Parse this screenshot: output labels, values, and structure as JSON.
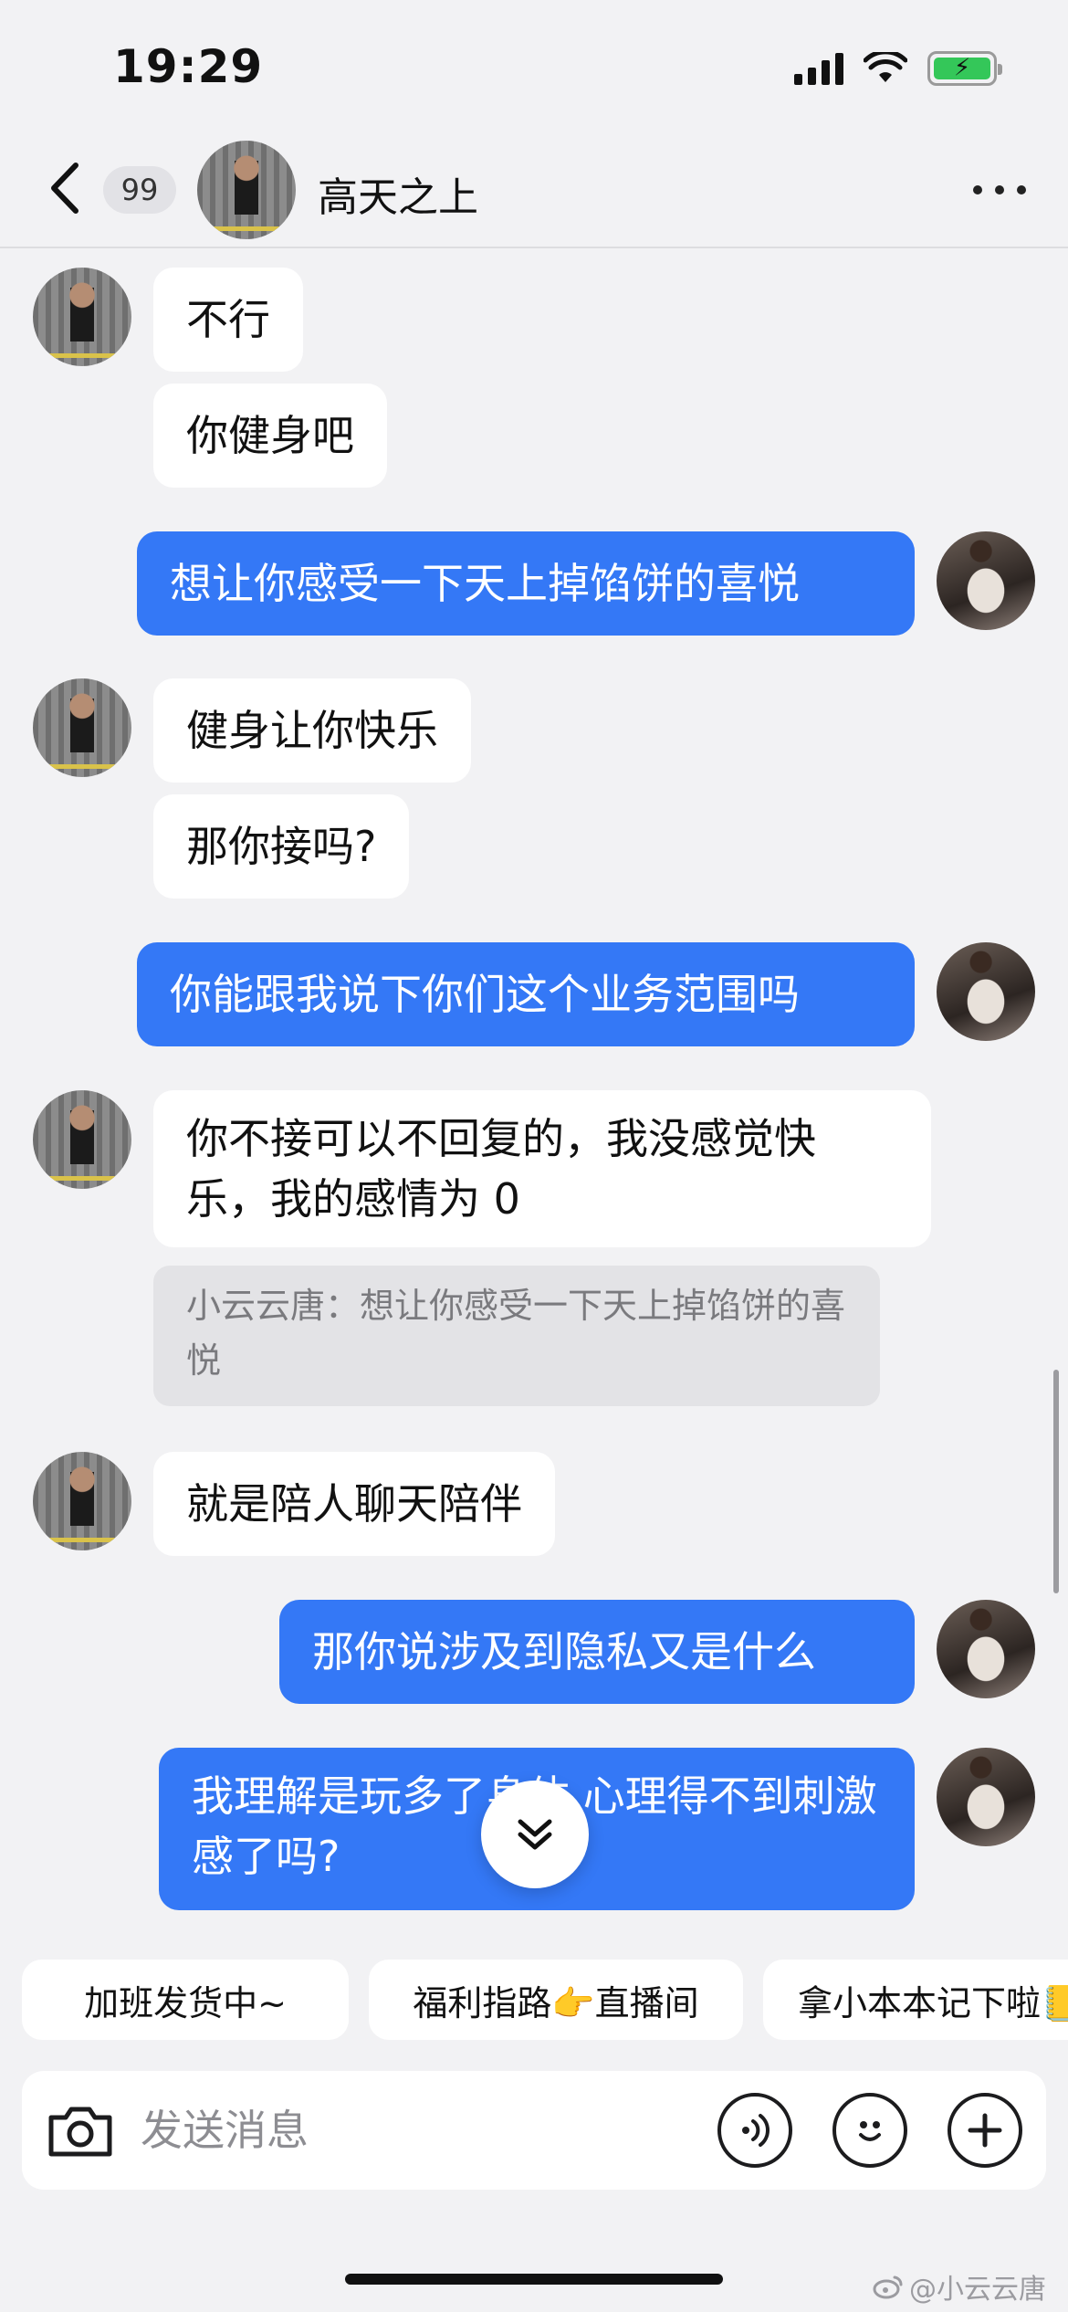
{
  "status_bar": {
    "time": "19:29"
  },
  "header": {
    "unread_count": "99",
    "contact_name": "高天之上"
  },
  "messages": [
    {
      "text": "不行"
    },
    {
      "text": "你健身吧"
    },
    {
      "text": "想让你感受一下天上掉馅饼的喜悦"
    },
    {
      "text": "健身让你快乐"
    },
    {
      "text": "那你接吗?"
    },
    {
      "text": "你能跟我说下你们这个业务范围吗"
    },
    {
      "text": "你不接可以不回复的，我没感觉快乐，我的感情为 0",
      "quote": "小云云唐：想让你感受一下天上掉馅饼的喜悦"
    },
    {
      "text": "就是陪人聊天陪伴"
    },
    {
      "text": "那你说涉及到隐私又是什么"
    },
    {
      "text": "我理解是玩多了身体 心理得不到刺激感了吗?"
    }
  ],
  "quick_replies": [
    "加班发货中~",
    "福利指路👉直播间",
    "拿小本本记下啦📒"
  ],
  "input": {
    "placeholder": "发送消息",
    "value": ""
  },
  "watermark": "@小云云唐",
  "colors": {
    "outgoing_bubble": "#3478f6",
    "incoming_bubble": "#ffffff",
    "background": "#f2f2f4",
    "quote_bg": "#e3e3e6"
  },
  "icons": [
    "back-icon",
    "more-icon",
    "camera-icon",
    "voice-icon",
    "emoji-icon",
    "plus-icon",
    "chevron-double-down-icon",
    "weibo-icon"
  ]
}
